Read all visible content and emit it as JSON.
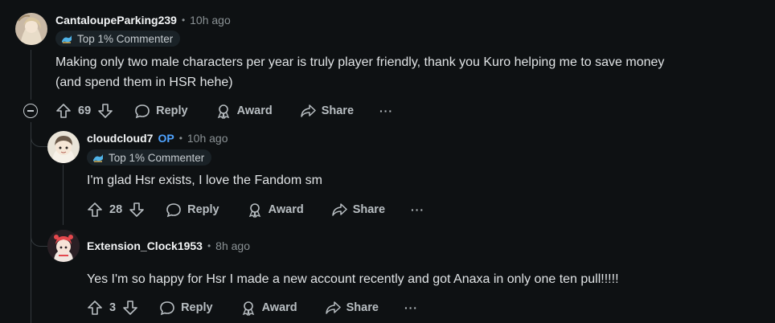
{
  "comments": [
    {
      "username": "CantaloupeParking239",
      "op_label": "",
      "time": "10h ago",
      "flair": "Top 1% Commenter",
      "text_line1": "Making only two male characters per year is truly player friendly, thank you Kuro helping me to save money",
      "text_line2": "(and spend them in HSR hehe)",
      "votes": "69",
      "reply_label": "Reply",
      "award_label": "Award",
      "share_label": "Share",
      "more_label": "···"
    },
    {
      "username": "cloudcloud7",
      "op_label": "OP",
      "time": "10h ago",
      "flair": "Top 1% Commenter",
      "text_line1": "I'm glad Hsr exists, I love the Fandom sm",
      "votes": "28",
      "reply_label": "Reply",
      "award_label": "Award",
      "share_label": "Share",
      "more_label": "···"
    },
    {
      "username": "Extension_Clock1953",
      "time": "8h ago",
      "text_line1": "Yes I'm so happy for Hsr I made a new account recently and got Anaxa in only one ten pull!!!!!",
      "votes": "3",
      "reply_label": "Reply",
      "award_label": "Award",
      "share_label": "Share",
      "more_label": "···"
    }
  ],
  "separator": "•",
  "colors": {
    "background": "#0e1113",
    "op_blue": "#4fa3ff",
    "muted": "#8a9194",
    "thread_line": "#33393d"
  },
  "icons": [
    "upvote-icon",
    "downvote-icon",
    "reply-bubble-icon",
    "award-icon",
    "share-arrow-icon",
    "more-dots-icon",
    "flair-wave-icon",
    "collapse-minus-icon"
  ]
}
